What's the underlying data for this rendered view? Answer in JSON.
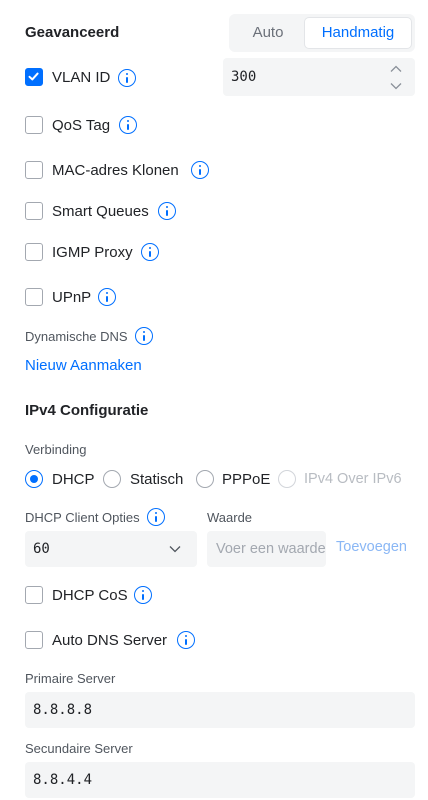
{
  "advanced": {
    "title": "Geavanceerd",
    "mode_options": [
      "Auto",
      "Handmatig"
    ],
    "mode_selected": "Handmatig"
  },
  "vlan": {
    "label": "VLAN ID",
    "checked": true,
    "value": "300"
  },
  "options": {
    "qos_tag": "QoS Tag",
    "mac_clone": "MAC-adres Klonen",
    "smart_queues": "Smart Queues",
    "igmp_proxy": "IGMP Proxy",
    "upnp": "UPnP"
  },
  "ddns": {
    "label": "Dynamische DNS",
    "create_link": "Nieuw Aanmaken"
  },
  "ipv4": {
    "title": "IPv4 Configuratie",
    "connection_label": "Verbinding",
    "connection_options": [
      "DHCP",
      "Statisch",
      "PPPoE",
      "IPv4 Over IPv6"
    ],
    "connection_selected": "DHCP",
    "dhcp_options_label": "DHCP Client Opties",
    "value_label": "Waarde",
    "dhcp_option_selected": "60",
    "value_placeholder": "Voer een waarde in",
    "add_label": "Toevoegen",
    "dhcp_cos": "DHCP CoS",
    "auto_dns": "Auto DNS Server",
    "primary_label": "Primaire Server",
    "primary_value": "8.8.8.8",
    "secondary_label": "Secundaire Server",
    "secondary_value": "8.8.4.4"
  },
  "colors": {
    "accent": "#006fff",
    "field_bg": "#f4f5f6",
    "text": "#212327",
    "muted": "#50565e"
  }
}
